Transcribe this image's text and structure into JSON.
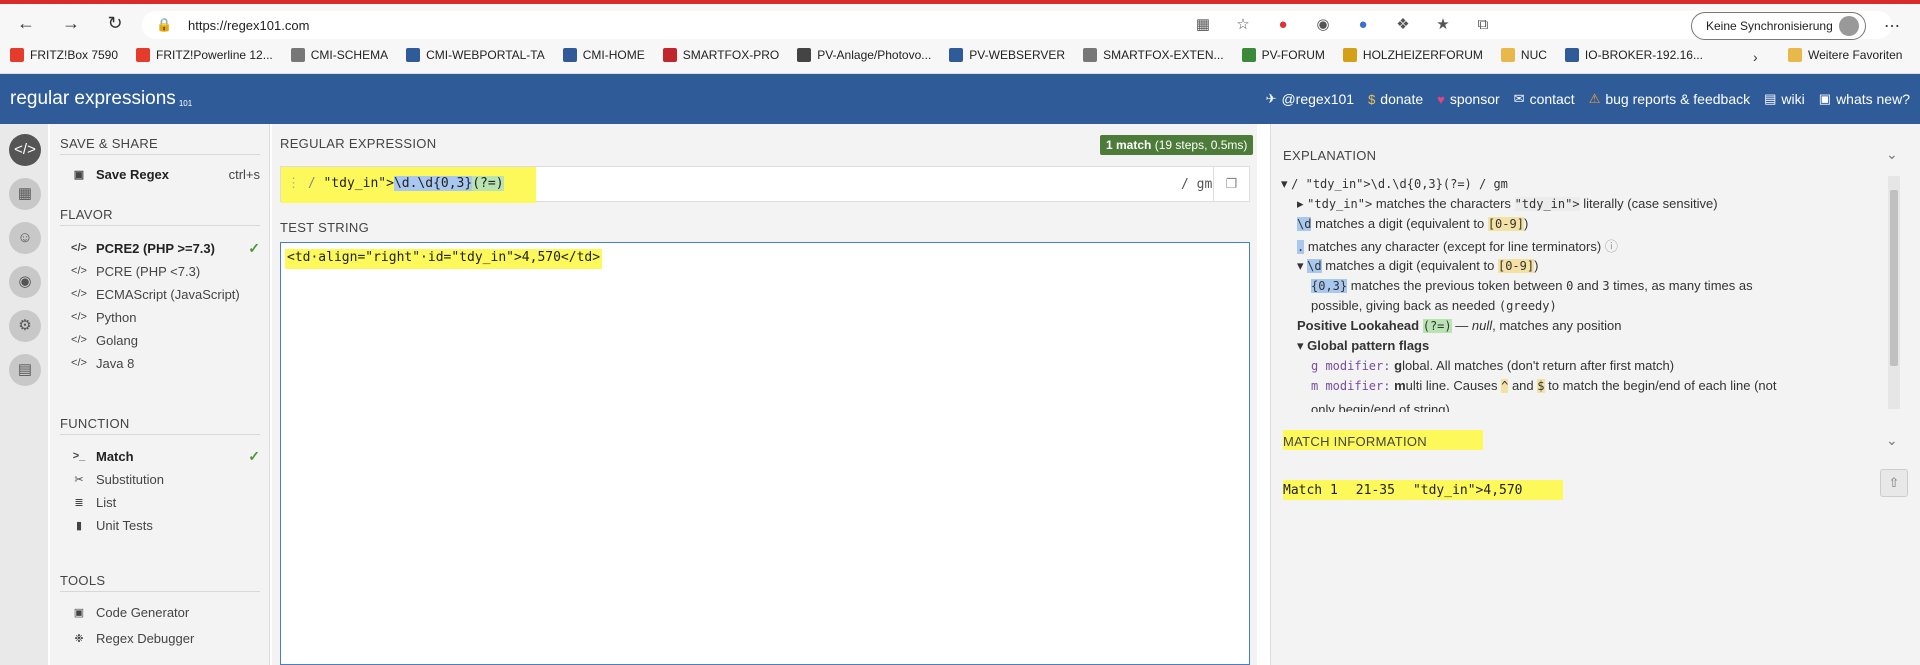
{
  "browser": {
    "url": "https://regex101.com",
    "sync_label": "Keine Synchronisierung",
    "bookmarks": [
      {
        "label": "FRITZ!Box 7590",
        "color": "#e53b2c"
      },
      {
        "label": "FRITZ!Powerline 12...",
        "color": "#e53b2c"
      },
      {
        "label": "CMI-SCHEMA",
        "color": "#777777"
      },
      {
        "label": "CMI-WEBPORTAL-TA",
        "color": "#2f5c99"
      },
      {
        "label": "CMI-HOME",
        "color": "#2f5c99"
      },
      {
        "label": "SMARTFOX-PRO",
        "color": "#c0272d"
      },
      {
        "label": "PV-Anlage/Photovo...",
        "color": "#444444"
      },
      {
        "label": "PV-WEBSERVER",
        "color": "#2f5c99"
      },
      {
        "label": "SMARTFOX-EXTEN...",
        "color": "#777777"
      },
      {
        "label": "PV-FORUM",
        "color": "#3a8a3a"
      },
      {
        "label": "HOLZHEIZERFORUM",
        "color": "#d4a017"
      },
      {
        "label": "NUC",
        "color": "#e8b84a"
      },
      {
        "label": "IO-BROKER-192.16...",
        "color": "#2f5c99"
      }
    ],
    "other_favorites": "Weitere Favoriten"
  },
  "header": {
    "logo": "regular expressions",
    "logo_sub": "101",
    "links": [
      {
        "icon": "twitter-icon",
        "label": "@regex101"
      },
      {
        "icon": "dollar-icon",
        "label": "donate"
      },
      {
        "icon": "heart-icon",
        "label": "sponsor"
      },
      {
        "icon": "mail-icon",
        "label": "contact"
      },
      {
        "icon": "warning-icon",
        "label": "bug reports & feedback"
      },
      {
        "icon": "book-icon",
        "label": "wiki"
      },
      {
        "icon": "gift-icon",
        "label": "whats new?"
      }
    ]
  },
  "sidebar": {
    "save_share_title": "SAVE & SHARE",
    "save_regex": "Save Regex",
    "save_shortcut": "ctrl+s",
    "flavor_title": "FLAVOR",
    "flavors": [
      "PCRE2 (PHP >=7.3)",
      "PCRE (PHP <7.3)",
      "ECMAScript (JavaScript)",
      "Python",
      "Golang",
      "Java 8"
    ],
    "function_title": "FUNCTION",
    "functions": [
      "Match",
      "Substitution",
      "List",
      "Unit Tests"
    ],
    "tools_title": "TOOLS",
    "tools": [
      "Code Generator",
      "Regex Debugger"
    ]
  },
  "editor": {
    "regex_title": "REGULAR EXPRESSION",
    "match_count": "1 match",
    "match_detail": "(19 steps, 0.5ms)",
    "regex_delim": "/",
    "regex_prefix": "\"tdy_in\">",
    "regex_digits": "\\d.\\d{0,3}",
    "regex_lookahead": "(?=)",
    "flags": "/ gm",
    "test_title": "TEST STRING",
    "test_string": "<td·align=\"right\"·id=\"tdy_in\">4,570</td>"
  },
  "explanation": {
    "title": "EXPLANATION",
    "root": "/ \"tdy_in\">\\d.\\d{0,3}(?=) / gm",
    "line1_token": "\"tdy_in\">",
    "line1_text_a": "matches the characters",
    "line1_text_b": "literally (case sensitive)",
    "line2_token": "\\d",
    "line2_text": "matches a digit (equivalent to",
    "line2_range": "[0-9]",
    "line3_token": ".",
    "line3_text": "matches any character (except for line terminators)",
    "line4_token": "\\d",
    "line4_text": "matches a digit (equivalent to",
    "line4_range": "[0-9]",
    "line5_token": "{0,3}",
    "line5_text_a": "matches the previous token between",
    "line5_n0": "0",
    "line5_and": "and",
    "line5_n3": "3",
    "line5_text_b": "times, as many times as",
    "line6_text": "possible, giving back as needed",
    "line6_mode": "(greedy)",
    "line7_bold": "Positive Lookahead",
    "line7_token": "(?=)",
    "line7_null": "null",
    "line7_text": ", matches any position",
    "line8": "Global pattern flags",
    "line9_code": "g modifier:",
    "line9_bold": "g",
    "line9_text": "lobal. All matches (don't return after first match)",
    "line10_code": "m modifier:",
    "line10_bold": "m",
    "line10_text_a": "ulti line. Causes",
    "line10_caret": "^",
    "line10_and": "and",
    "line10_dollar": "$",
    "line10_text_b": "to match the begin/end of each line (not",
    "line11_text": "only begin/end of string)"
  },
  "match_info": {
    "title": "MATCH INFORMATION",
    "match_label": "Match 1",
    "range": "21-35",
    "value": "\"tdy_in\">4,570"
  }
}
